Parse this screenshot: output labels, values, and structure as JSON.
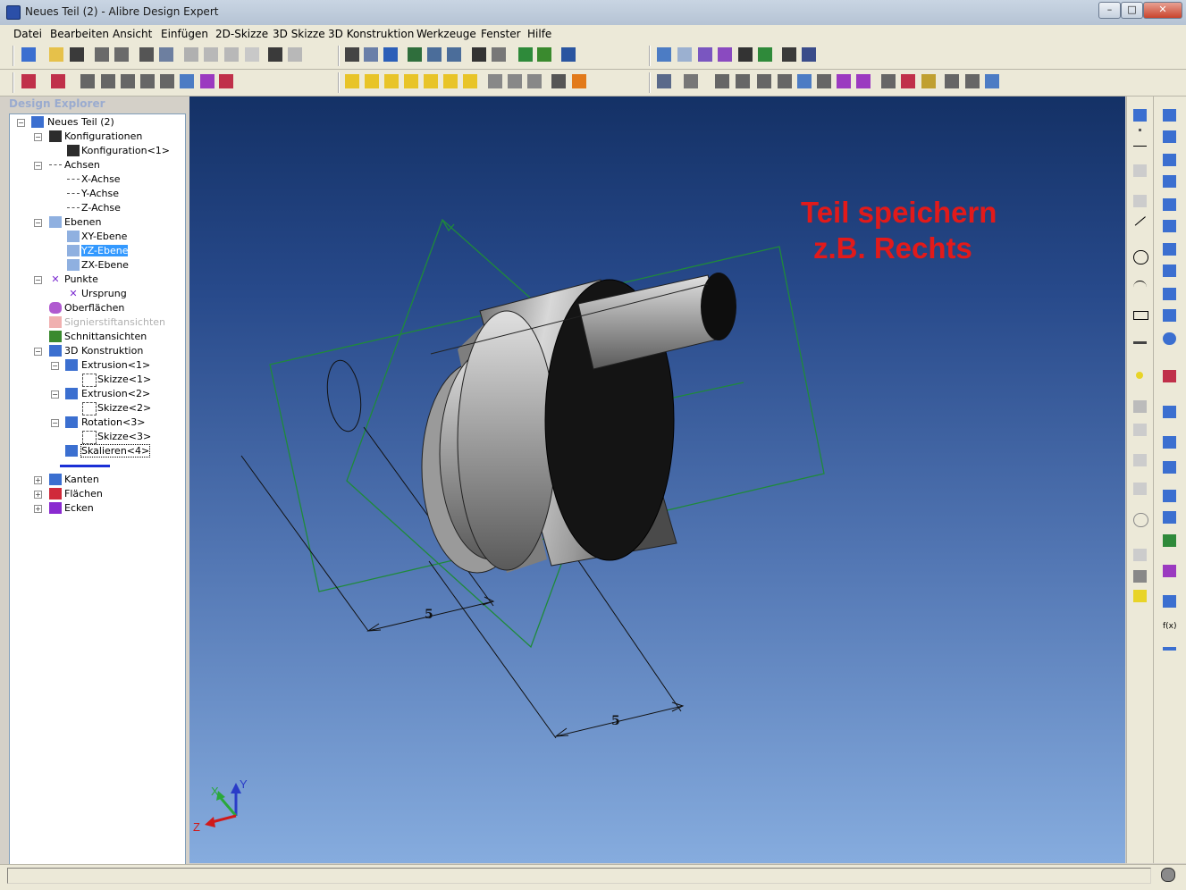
{
  "window": {
    "title": "Neues Teil (2) - Alibre Design Expert",
    "minimize": "–",
    "maximize": "□",
    "close": "✕"
  },
  "menu": [
    "Datei",
    "Bearbeiten",
    "Ansicht",
    "Einfügen",
    "2D-Skizze",
    "3D Skizze",
    "3D Konstruktion",
    "Werkzeuge",
    "Fenster",
    "Hilfe"
  ],
  "explorer": {
    "title": "Design Explorer",
    "nodes": {
      "root": "Neues Teil (2)",
      "konfigurationen": "Konfigurationen",
      "konfiguration1": "Konfiguration<1>",
      "achsen": "Achsen",
      "x_achse": "X-Achse",
      "y_achse": "Y-Achse",
      "z_achse": "Z-Achse",
      "ebenen": "Ebenen",
      "xy_ebene": "XY-Ebene",
      "yz_ebene": "YZ-Ebene",
      "zx_ebene": "ZX-Ebene",
      "punkte": "Punkte",
      "ursprung": "Ursprung",
      "oberflaechen": "Oberflächen",
      "signierstift": "Signierstiftansichten",
      "schnittansichten": "Schnittansichten",
      "konstruktion": "3D Konstruktion",
      "extrusion1": "Extrusion<1>",
      "skizze1": "Skizze<1>",
      "extrusion2": "Extrusion<2>",
      "skizze2": "Skizze<2>",
      "rotation3": "Rotation<3>",
      "skizze3": "Skizze<3>",
      "skalieren4": "Skalieren<4>",
      "kanten": "Kanten",
      "flaechen": "Flächen",
      "ecken": "Ecken"
    }
  },
  "viewport": {
    "annotation_line1": "Teil speichern",
    "annotation_line2": "z.B. Rechts",
    "dim1": "5",
    "dim2": "5",
    "triad": {
      "x": "X",
      "y": "Y",
      "z": "Z"
    }
  },
  "colors": {
    "annotation": "#e21a1a",
    "sketch_green": "#1f8a3a",
    "viewport_top": "#143166",
    "viewport_bottom": "#86acde",
    "selection": "#3399ff"
  }
}
